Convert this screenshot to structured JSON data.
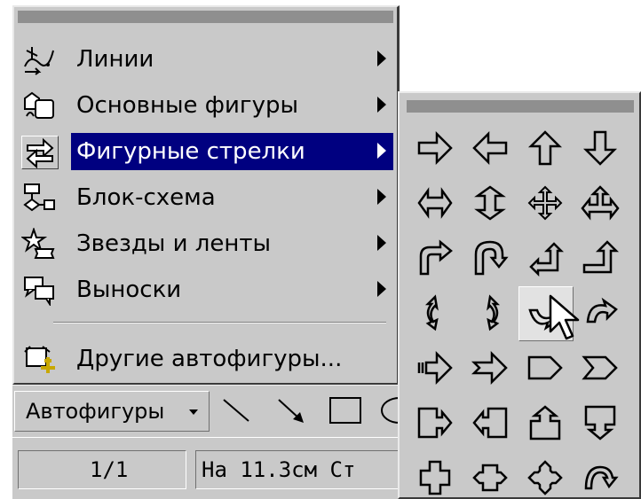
{
  "menu": {
    "items": [
      {
        "label": "Линии",
        "icon": "lines-icon",
        "has_submenu": true
      },
      {
        "label": "Основные фигуры",
        "icon": "basic-shapes-icon",
        "has_submenu": true
      },
      {
        "label": "Фигурные стрелки",
        "icon": "block-arrows-icon",
        "has_submenu": true,
        "highlighted": true
      },
      {
        "label": "Блок-схема",
        "icon": "flowchart-icon",
        "has_submenu": true
      },
      {
        "label": "Звезды и ленты",
        "icon": "stars-banners-icon",
        "has_submenu": true
      },
      {
        "label": "Выноски",
        "icon": "callouts-icon",
        "has_submenu": true
      },
      {
        "label": "Другие автофигуры...",
        "icon": "more-autoshapes-icon",
        "has_submenu": false
      }
    ]
  },
  "toolbar": {
    "autoshapes_label": "Автофигуры",
    "tools": [
      "line-tool-icon",
      "arrow-tool-icon",
      "rectangle-tool-icon",
      "oval-tool-icon"
    ]
  },
  "statusbar": {
    "page": "1/1",
    "position": "На 11.3см Ст"
  },
  "submenu": {
    "selected_shape": "u-turn-arrow",
    "shapes": [
      "right-arrow",
      "left-arrow",
      "up-arrow",
      "down-arrow",
      "left-right-arrow",
      "up-down-arrow",
      "quad-arrow",
      "left-right-up-arrow",
      "bent-arrow",
      "u-turn-arrow",
      "left-up-arrow",
      "bent-up-arrow",
      "curved-right-arrow",
      "curved-left-arrow",
      "curved-up-arrow",
      "curved-down-arrow",
      "striped-right-arrow",
      "notched-right-arrow",
      "pentagon",
      "chevron",
      "right-arrow-callout",
      "left-arrow-callout",
      "up-arrow-callout",
      "down-arrow-callout",
      "up-down-arrow-callout",
      "left-right-arrow-callout",
      "quad-arrow-callout",
      "circular-arrow"
    ]
  },
  "colors": {
    "menu_bg": "#c9c9c9",
    "highlight": "#000080",
    "titlebar": "#8f8f8f"
  }
}
